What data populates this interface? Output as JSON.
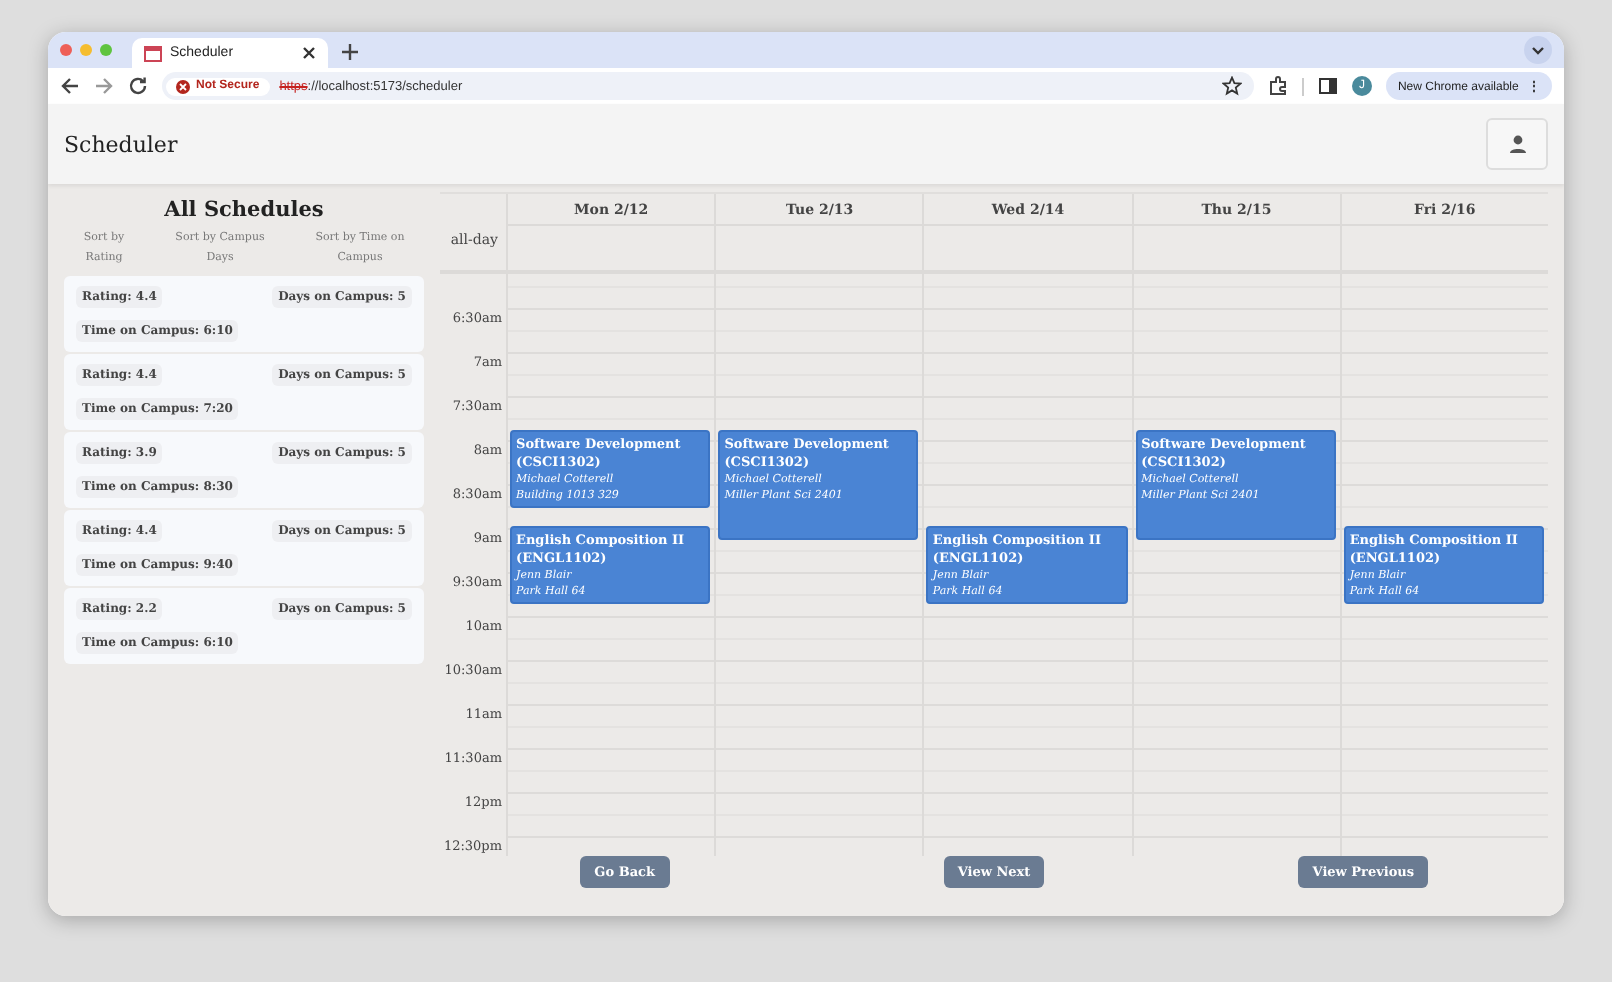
{
  "browser": {
    "tab": {
      "title": "Scheduler",
      "selected": true
    },
    "security": "Not Secure",
    "url_scheme": "https",
    "url_rest": "://localhost:5173/scheduler",
    "profile": "J",
    "update_button": "New Chrome available",
    "menu": "⋮"
  },
  "app": {
    "title": "Scheduler"
  },
  "schedules_panel": {
    "heading": "All Schedules",
    "sort_options": [
      "Sort by Rating",
      "Sort by Campus Days",
      "Sort by Time on Campus"
    ],
    "schedules": [
      {
        "rating": "Rating: 4.4",
        "days": "Days on Campus: 5",
        "time": "Time on Campus: 6:10"
      },
      {
        "rating": "Rating: 4.4",
        "days": "Days on Campus: 5",
        "time": "Time on Campus: 7:20"
      },
      {
        "rating": "Rating: 3.9",
        "days": "Days on Campus: 5",
        "time": "Time on Campus: 8:30"
      },
      {
        "rating": "Rating: 4.4",
        "days": "Days on Campus: 5",
        "time": "Time on Campus: 9:40"
      },
      {
        "rating": "Rating: 2.2",
        "days": "Days on Campus: 5",
        "time": "Time on Campus: 6:10"
      }
    ]
  },
  "calendar": {
    "all_day_label": "all-day",
    "time_labels": [
      "6:30am",
      "7am",
      "7:30am",
      "8am",
      "8:30am",
      "9am",
      "9:30am",
      "10am",
      "10:30am",
      "11am",
      "11:30am",
      "12pm",
      "12:30pm"
    ],
    "days": [
      {
        "label": "Mon 2/12",
        "events": [
          {
            "title": "Software Development",
            "code": "(CSCI1302)",
            "instructor": "Michael Cotterell",
            "location": "Building 1013 329"
          },
          {
            "title": "English Composition II",
            "code": "(ENGL1102)",
            "instructor": "Jenn Blair",
            "location": "Park Hall 64"
          }
        ]
      },
      {
        "label": "Tue 2/13",
        "events": [
          {
            "title": "Software Development",
            "code": "(CSCI1302)",
            "instructor": "Michael Cotterell",
            "location": "Miller Plant Sci 2401"
          }
        ]
      },
      {
        "label": "Wed 2/14",
        "events": [
          {
            "title": "English Composition II",
            "code": "(ENGL1102)",
            "instructor": "Jenn Blair",
            "location": "Park Hall 64"
          }
        ]
      },
      {
        "label": "Thu 2/15",
        "events": [
          {
            "title": "Software Development",
            "code": "(CSCI1302)",
            "instructor": "Michael Cotterell",
            "location": "Miller Plant Sci 2401"
          }
        ]
      },
      {
        "label": "Fri 2/16",
        "events": [
          {
            "title": "English Composition II",
            "code": "(ENGL1102)",
            "instructor": "Jenn Blair",
            "location": "Park Hall 64"
          }
        ]
      }
    ]
  },
  "buttons": [
    "Go Back",
    "View Next",
    "View Previous"
  ]
}
